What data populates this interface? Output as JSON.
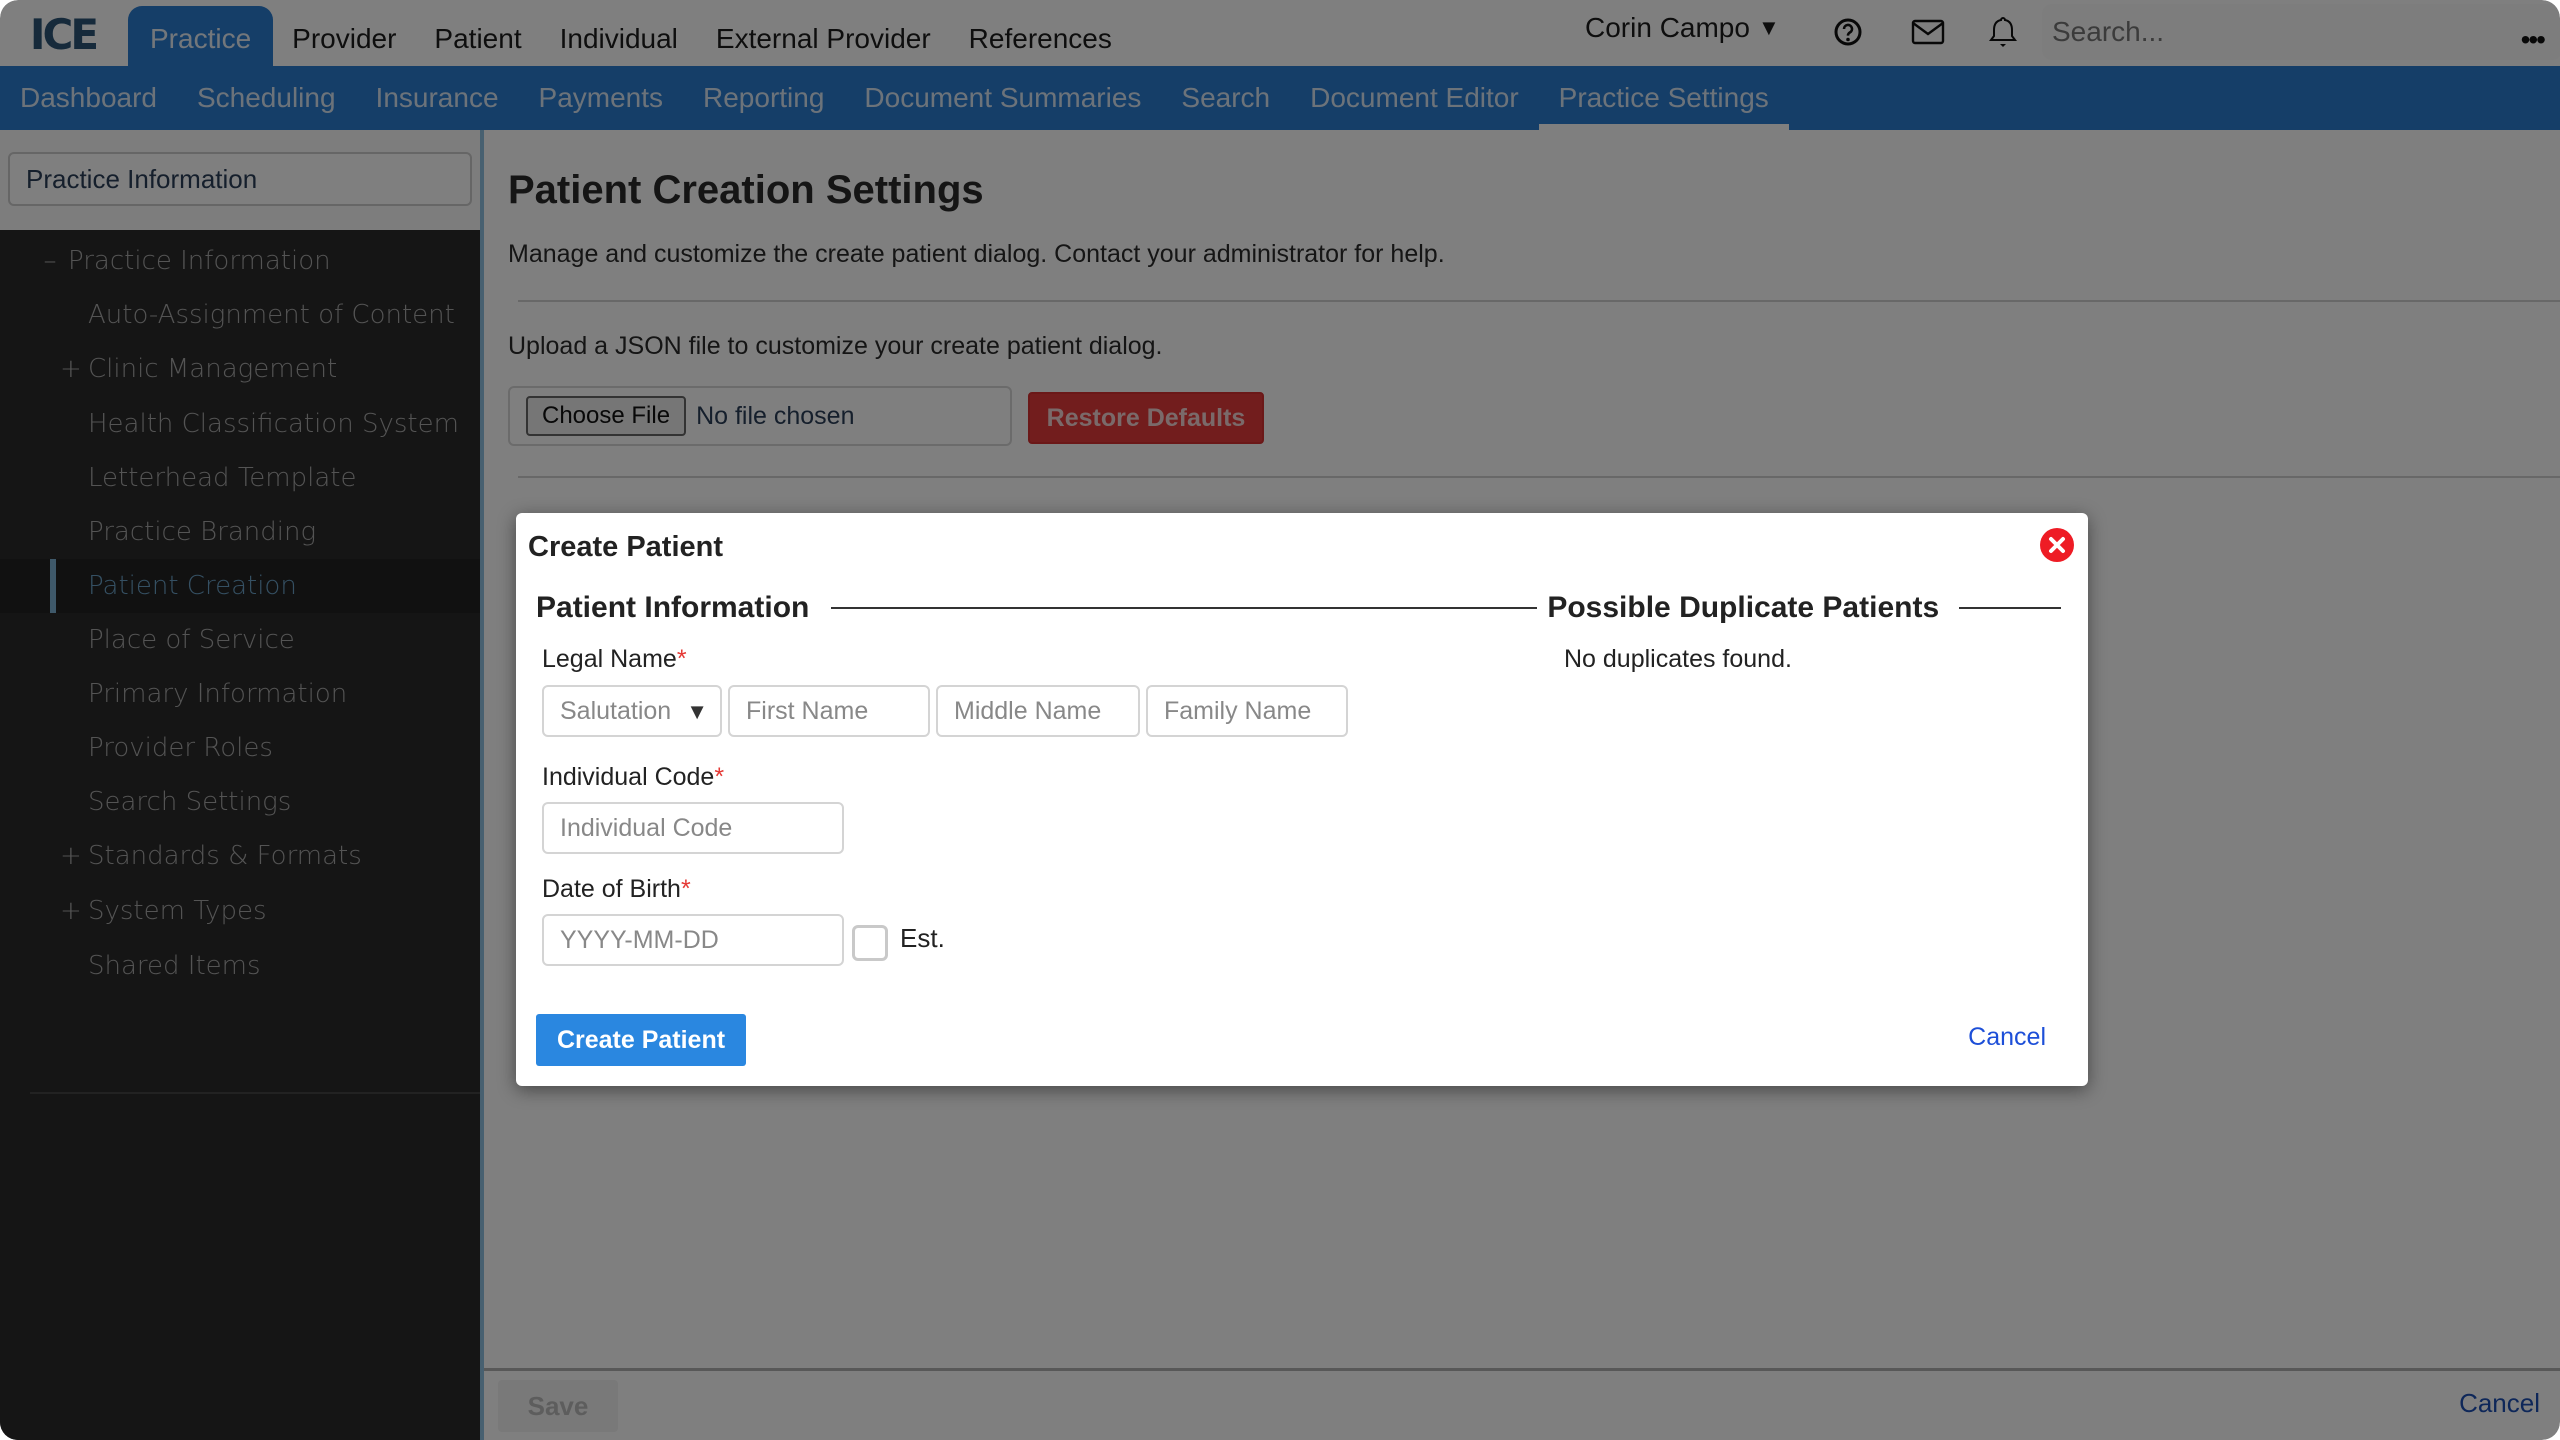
{
  "app": {
    "logo_text": "ICE"
  },
  "main_nav": {
    "tabs": [
      {
        "label": "Practice",
        "active": true
      },
      {
        "label": "Provider",
        "active": false
      },
      {
        "label": "Patient",
        "active": false
      },
      {
        "label": "Individual",
        "active": false
      },
      {
        "label": "External Provider",
        "active": false
      },
      {
        "label": "References",
        "active": false
      }
    ],
    "user_name": "Corin Campo",
    "icons": [
      "help-icon",
      "mail-icon",
      "bell-icon",
      "more-icon"
    ],
    "search_placeholder": "Search..."
  },
  "sub_nav": {
    "tabs": [
      {
        "label": "Dashboard",
        "active": false
      },
      {
        "label": "Scheduling",
        "active": false
      },
      {
        "label": "Insurance",
        "active": false
      },
      {
        "label": "Payments",
        "active": false
      },
      {
        "label": "Reporting",
        "active": false
      },
      {
        "label": "Document Summaries",
        "active": false
      },
      {
        "label": "Search",
        "active": false
      },
      {
        "label": "Document Editor",
        "active": false
      },
      {
        "label": "Practice Settings",
        "active": true
      }
    ]
  },
  "sidebar": {
    "search_value": "Practice Information",
    "items": [
      {
        "label": "Practice Information",
        "toggle": "–",
        "level": 0
      },
      {
        "label": "Auto-Assignment of Content",
        "toggle": "",
        "level": 1
      },
      {
        "label": "Clinic Management",
        "toggle": "+",
        "level": 1
      },
      {
        "label": "Health Classification System",
        "toggle": "",
        "level": 1
      },
      {
        "label": "Letterhead Template",
        "toggle": "",
        "level": 1
      },
      {
        "label": "Practice Branding",
        "toggle": "",
        "level": 1
      },
      {
        "label": "Patient Creation",
        "toggle": "",
        "level": 1,
        "active": true
      },
      {
        "label": "Place of Service",
        "toggle": "",
        "level": 1
      },
      {
        "label": "Primary Information",
        "toggle": "",
        "level": 1
      },
      {
        "label": "Provider Roles",
        "toggle": "",
        "level": 1
      },
      {
        "label": "Search Settings",
        "toggle": "",
        "level": 1
      },
      {
        "label": "Standards & Formats",
        "toggle": "+",
        "level": 1
      },
      {
        "label": "System Types",
        "toggle": "+",
        "level": 1
      },
      {
        "label": "Shared Items",
        "toggle": "",
        "level": 1
      }
    ]
  },
  "content": {
    "title": "Patient Creation Settings",
    "description": "Manage and customize the create patient dialog. Contact your administrator for help.",
    "upload_text": "Upload a JSON file to customize your create patient dialog.",
    "choose_file_label": "Choose File",
    "file_status": "No file chosen",
    "restore_defaults_label": "Restore Defaults",
    "save_label": "Save",
    "cancel_label": "Cancel"
  },
  "modal": {
    "title": "Create Patient",
    "patient_info_heading": "Patient Information",
    "duplicates_heading": "Possible Duplicate Patients",
    "duplicates_text": "No duplicates found.",
    "legal_name_label": "Legal Name",
    "salutation_placeholder": "Salutation",
    "first_name_placeholder": "First Name",
    "middle_name_placeholder": "Middle Name",
    "family_name_placeholder": "Family Name",
    "individual_code_label": "Individual Code",
    "individual_code_placeholder": "Individual Code",
    "dob_label": "Date of Birth",
    "dob_placeholder": "YYYY-MM-DD",
    "est_label": "Est.",
    "est_checked": false,
    "required_marker": "*",
    "create_label": "Create Patient",
    "cancel_label": "Cancel"
  },
  "colors": {
    "brand_blue": "#2a7cd0",
    "primary_button": "#2a87e0",
    "danger": "#e53a3a",
    "close_icon": "#ee1c25",
    "link": "#1d4fd8"
  }
}
